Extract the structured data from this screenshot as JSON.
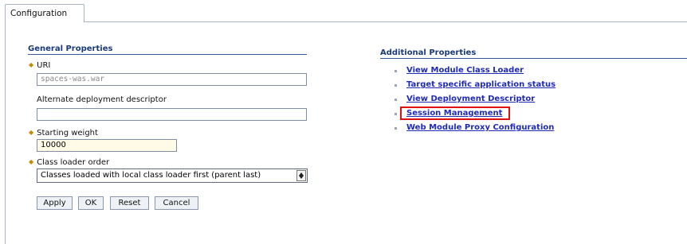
{
  "tab": {
    "label": "Configuration"
  },
  "general": {
    "title": "General Properties",
    "uri": {
      "label": "URI",
      "value": "spaces-was.war"
    },
    "alt_descriptor": {
      "label": "Alternate deployment descriptor",
      "value": ""
    },
    "starting_weight": {
      "label": "Starting weight",
      "value": "10000"
    },
    "class_loader_order": {
      "label": "Class loader order",
      "value": "Classes loaded with local class loader first (parent last)"
    }
  },
  "buttons": {
    "apply": "Apply",
    "ok": "OK",
    "reset": "Reset",
    "cancel": "Cancel"
  },
  "additional": {
    "title": "Additional Properties",
    "links": [
      "View Module Class Loader",
      "Target specific application status",
      "View Deployment Descriptor",
      "Session Management",
      "Web Module Proxy Configuration"
    ]
  },
  "colors": {
    "link": "#1f2bb8",
    "highlight_box": "#e01010",
    "section_title": "#1a3a7a"
  }
}
